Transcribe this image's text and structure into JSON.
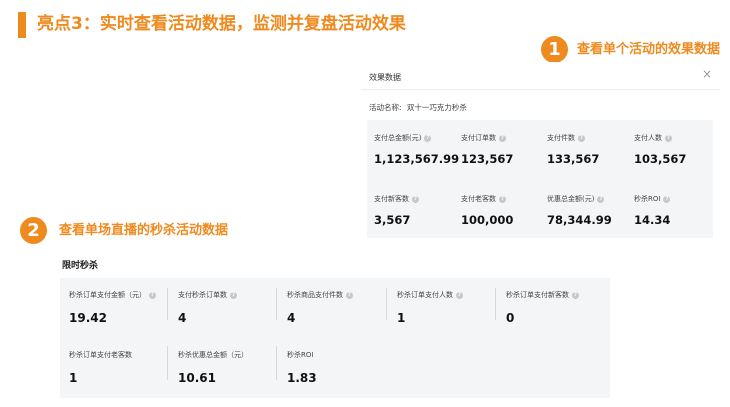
{
  "main_title": "亮点3：实时查看活动数据，监测并复盘活动效果",
  "step1": {
    "number": "1",
    "title": "查看单个活动的效果数据"
  },
  "step2": {
    "number": "2",
    "title": "查看单场直播的秒杀活动数据"
  },
  "panel": {
    "header": "效果数据",
    "close_icon": "×",
    "activity_label": "活动名称:",
    "activity_name": "双十一巧克力秒杀",
    "metrics": [
      {
        "label": "支付总金额(元)",
        "value": "1,123,567.99"
      },
      {
        "label": "支付订单数",
        "value": "123,567"
      },
      {
        "label": "支付件数",
        "value": "133,567"
      },
      {
        "label": "支付人数",
        "value": "103,567"
      },
      {
        "label": "支付新客数",
        "value": "3,567"
      },
      {
        "label": "支付老客数",
        "value": "100,000"
      },
      {
        "label": "优惠总金额(元)",
        "value": "78,344.99"
      },
      {
        "label": "秒杀ROI",
        "value": "14.34"
      }
    ]
  },
  "section": {
    "title": "限时秒杀",
    "metrics": [
      {
        "label": "秒杀订单支付金额（元）",
        "value": "19.42"
      },
      {
        "label": "支付秒杀订单数",
        "value": "4"
      },
      {
        "label": "秒杀商品支付件数",
        "value": "4"
      },
      {
        "label": "秒杀订单支付人数",
        "value": "1"
      },
      {
        "label": "秒杀订单支付新客数",
        "value": "0"
      },
      {
        "label": "秒杀订单支付老客数",
        "value": "1"
      },
      {
        "label": "秒杀优惠总金额（元）",
        "value": "10.61"
      },
      {
        "label": "秒杀ROI",
        "value": "1.83"
      }
    ]
  },
  "help_icon": "?",
  "colors": {
    "accent": "#ef8a1f",
    "grid_bg": "#f4f5f7"
  }
}
